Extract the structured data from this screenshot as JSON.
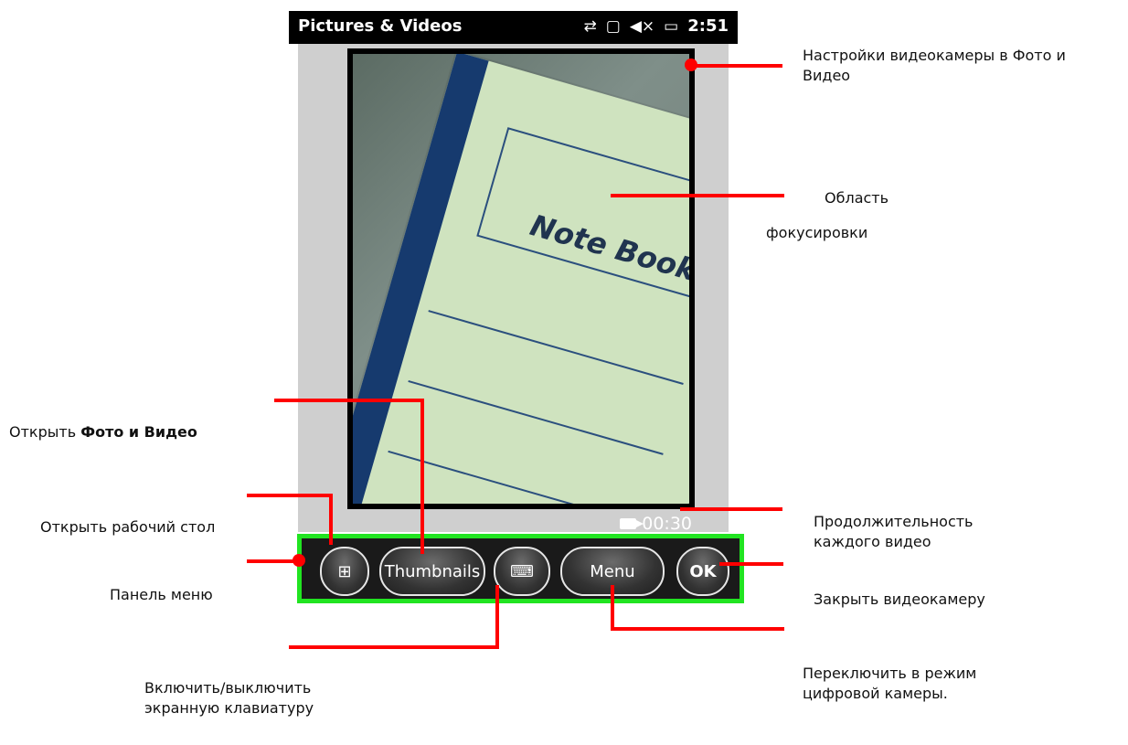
{
  "status_bar": {
    "app_title": "Pictures & Videos",
    "time": "2:51",
    "icons": {
      "sync": "⇄",
      "signal": "▢",
      "volume": "◀×",
      "battery": "▭"
    }
  },
  "camera": {
    "duration": "00:30"
  },
  "notebook": {
    "title": "Note Book"
  },
  "menu_bar": {
    "thumbnails_label": "Thumbnails",
    "keyboard_label": "⌨",
    "menu_label": "Menu",
    "ok_label": "OK",
    "start_label": "⊞"
  },
  "annotations": {
    "settings": "Настройки видеокамеры в Фото и Видео",
    "focus_line1": "Область",
    "focus_line2": "фокусировки",
    "open_pictures_prefix": "Открыть ",
    "open_pictures_bold": "Фото и Видео",
    "open_desktop": "Открыть рабочий стол",
    "menu_panel": "Панель меню",
    "duration_desc": "Продолжительность каждого видео",
    "close_camera": "Закрыть видеокамеру",
    "switch_mode": "Переключить в режим цифровой камеры.",
    "toggle_keyboard": "Включить/выключить экранную клавиатуру"
  },
  "colors": {
    "accent": "#ff0000",
    "menu_bar_border": "#21e421"
  }
}
